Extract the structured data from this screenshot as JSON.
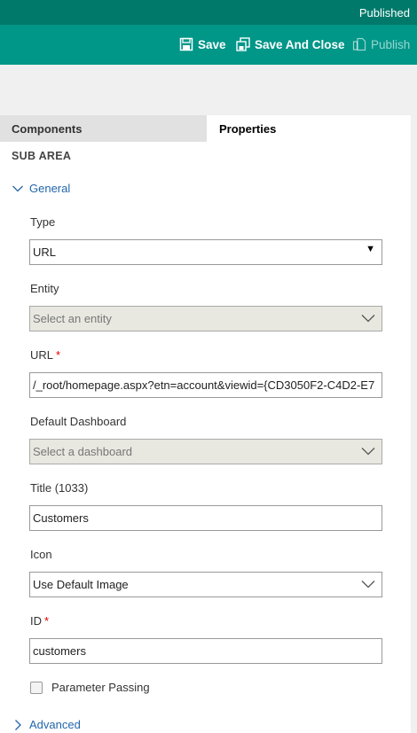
{
  "status": {
    "text": "Published"
  },
  "toolbar": {
    "save_label": "Save",
    "save_close_label": "Save And Close",
    "publish_label": "Publish"
  },
  "tabs": [
    {
      "label": "Components",
      "active": false
    },
    {
      "label": "Properties",
      "active": true
    }
  ],
  "panel": {
    "section_title": "SUB AREA",
    "general_label": "General",
    "advanced_label": "Advanced"
  },
  "fields": {
    "type": {
      "label": "Type",
      "value": "URL"
    },
    "entity": {
      "label": "Entity",
      "placeholder": "Select an entity"
    },
    "url": {
      "label": "URL",
      "required_mark": "*",
      "value": "/_root/homepage.aspx?etn=account&viewid={CD3050F2-C4D2-E7"
    },
    "dashboard": {
      "label": "Default Dashboard",
      "placeholder": "Select a dashboard"
    },
    "title": {
      "label": "Title (1033)",
      "value": "Customers"
    },
    "icon": {
      "label": "Icon",
      "value": "Use Default Image"
    },
    "id": {
      "label": "ID",
      "required_mark": "*",
      "value": "customers"
    },
    "parameter_passing": {
      "label": "Parameter Passing",
      "checked": false
    }
  },
  "colors": {
    "status_bar": "#00796b",
    "toolbar": "#009688",
    "link": "#2266aa",
    "required": "#dd0000"
  }
}
